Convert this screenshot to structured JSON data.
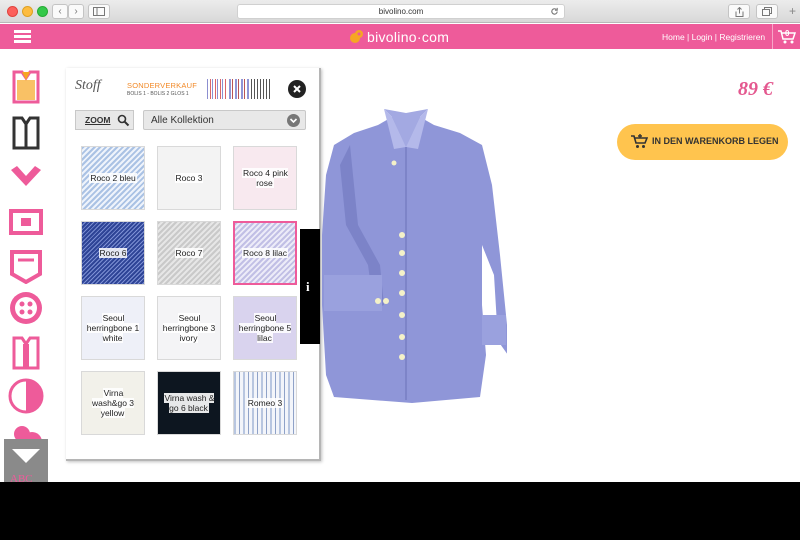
{
  "browser": {
    "url": "bivolino.com"
  },
  "site": {
    "brand": "bivolino·com",
    "nav_links": "Home | Login | Registrieren",
    "cart_count": "0",
    "price": "89 €",
    "add_to_cart_label": "IN DEN WARENKORB LEGEN"
  },
  "panel": {
    "title": "Stoff",
    "promo_title": "SONDERVERKAUF",
    "promo_sub": "BOLIS 1 - BOLIS 2  GLOS 1",
    "zoom_label": "ZOOM",
    "collection_selected": "Alle Kollektion",
    "info_label": "i",
    "fabrics": [
      {
        "name": "Roco 2 bleu"
      },
      {
        "name": "Roco 3"
      },
      {
        "name": "Roco 4 pink rose"
      },
      {
        "name": "Roco 6"
      },
      {
        "name": "Roco 7"
      },
      {
        "name": "Roco 8 lilac"
      },
      {
        "name": "Seoul herringbone 1 white"
      },
      {
        "name": "Seoul herringbone 3 ivory"
      },
      {
        "name": "Seoul herringbone 5 lilac"
      },
      {
        "name": "Virna wash&go 3 yellow"
      },
      {
        "name": "Virna wash & go 6 black"
      },
      {
        "name": "Romeo 3"
      }
    ]
  },
  "sidebar": {
    "bottom_text": "ABC"
  },
  "colors": {
    "brand_pink": "#ee5b9a",
    "price_pink": "#e4588f",
    "cart_button": "#ffc44e",
    "shirt": "#8f96d8",
    "promo_orange": "#f28a28"
  }
}
